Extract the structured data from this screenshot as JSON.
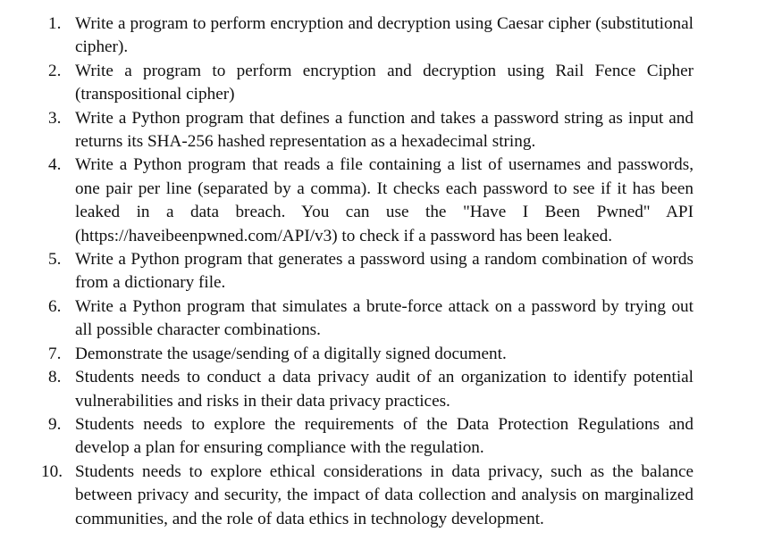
{
  "document": {
    "items": [
      {
        "number": "1.",
        "text": "Write a program to perform encryption and decryption using Caesar cipher (substitutional cipher)."
      },
      {
        "number": "2.",
        "text": "Write a program to perform encryption and decryption using Rail Fence Cipher (transpositional cipher)"
      },
      {
        "number": "3.",
        "text": "Write a Python program that defines a function and takes a password string as input and returns its SHA-256 hashed representation as a hexadecimal string."
      },
      {
        "number": "4.",
        "text": "Write a Python program that reads a file containing a list of usernames and passwords, one pair per line (separated by a comma). It checks each password to see if it has been leaked in a data breach. You can use the \"Have I Been Pwned\" API (https://haveibeenpwned.com/API/v3) to check if a password has been leaked."
      },
      {
        "number": "5.",
        "text": "Write a Python program that generates a password using a random combination of words from a dictionary file."
      },
      {
        "number": "6.",
        "text": "Write a Python program that simulates a brute-force attack on a password by trying out all possible character combinations."
      },
      {
        "number": "7.",
        "text": "Demonstrate the usage/sending of a digitally signed document."
      },
      {
        "number": "8.",
        "text": "Students needs to conduct a data privacy audit of an organization to identify potential vulnerabilities and risks in their data privacy practices."
      },
      {
        "number": "9.",
        "text": "Students needs to explore the requirements of the Data Protection Regulations and develop a plan for ensuring compliance with the regulation."
      },
      {
        "number": "10.",
        "text": "Students needs to explore ethical considerations in data privacy, such as the balance between privacy and security, the impact of data collection and analysis on marginalized communities, and the role of data ethics in technology development."
      }
    ]
  }
}
